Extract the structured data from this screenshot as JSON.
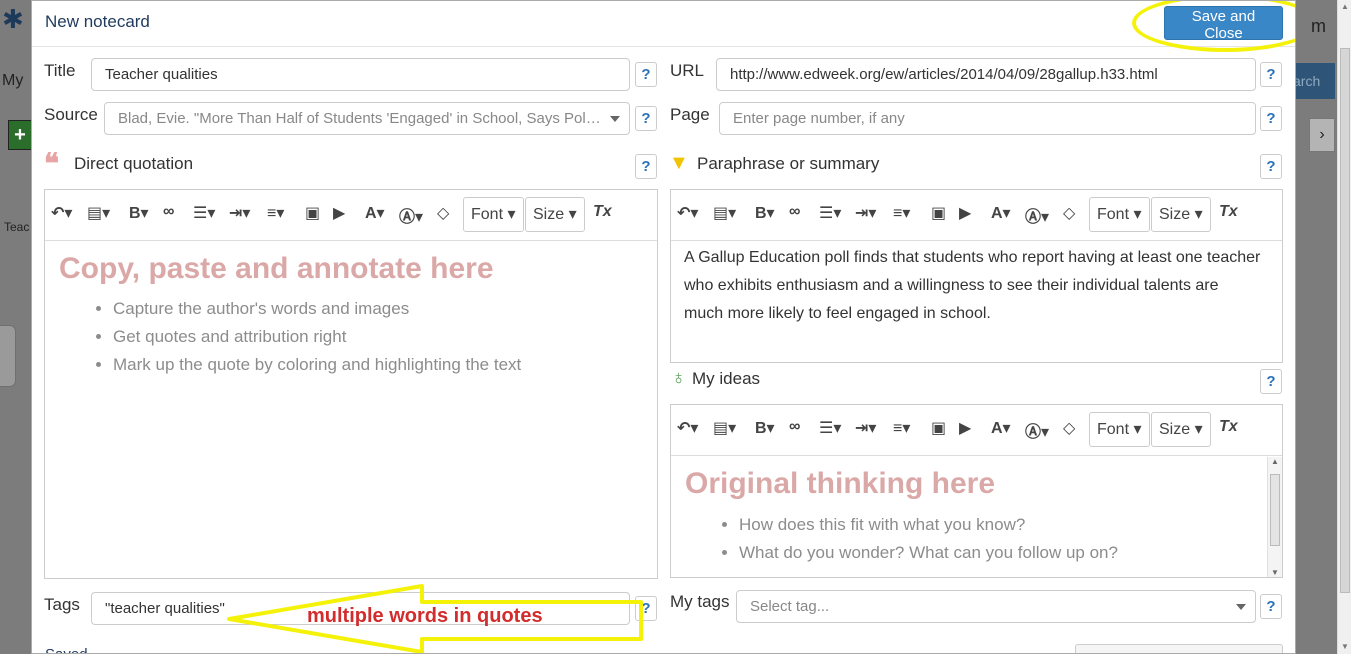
{
  "background": {
    "my_label": "My",
    "teac_label": "Teac",
    "search_label": "arch",
    "right_letter": "m"
  },
  "modal": {
    "title": "New notecard",
    "save_close_label": "Save and Close",
    "status": "Saved"
  },
  "fields": {
    "title_label": "Title",
    "title_value": "Teacher qualities",
    "url_label": "URL",
    "url_value": "http://www.edweek.org/ew/articles/2014/04/09/28gallup.h33.html",
    "source_label": "Source",
    "source_value": "Blad, Evie. \"More Than Half of Students 'Engaged' in School, Says Pol…",
    "page_label": "Page",
    "page_placeholder": "Enter page number, if any",
    "tags_label": "Tags",
    "tags_value": "\"teacher qualities\"",
    "mytags_label": "My tags",
    "mytags_placeholder": "Select tag...",
    "help_symbol": "?"
  },
  "sections": {
    "quotation_label": "Direct quotation",
    "paraphrase_label": "Paraphrase or summary",
    "ideas_label": "My ideas"
  },
  "toolbar": {
    "font_label": "Font",
    "size_label": "Size"
  },
  "quotation_editor": {
    "hint_title": "Copy, paste and annotate here",
    "hints": [
      "Capture the author's words and images",
      "Get quotes and attribution right",
      "Mark up the quote by coloring and highlighting the text"
    ]
  },
  "paraphrase_editor": {
    "text": "A Gallup Education poll finds that students who report having at least one teacher who exhibits enthusiasm and a willingness to see their individual talents are much more likely to feel engaged in school."
  },
  "ideas_editor": {
    "hint_title": "Original thinking here",
    "hints": [
      "How does this fit with what you know?",
      "What do you wonder? What can you follow up on?"
    ]
  },
  "annotation": {
    "arrow_text": "multiple words in quotes",
    "color": "#f5f20a",
    "text_color": "#d22c2c"
  },
  "colors": {
    "primary_button": "#3a87c7",
    "title_text": "#1f3a5c",
    "hint_title": "#dba8a8",
    "help_icon": "#2b72b8"
  }
}
